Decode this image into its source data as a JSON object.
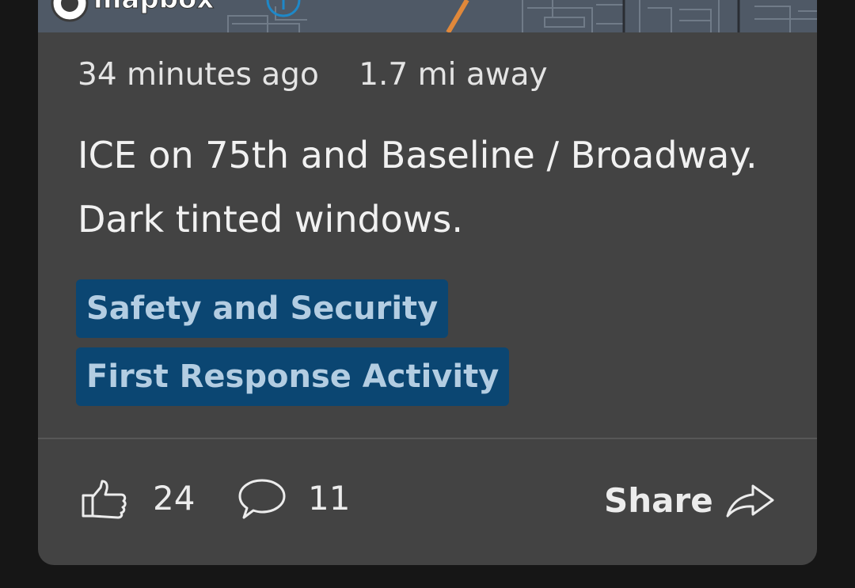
{
  "map": {
    "attribution": "mapbox"
  },
  "post": {
    "time_ago": "34 minutes ago",
    "distance": "1.7 mi away",
    "description": "ICE on 75th and Baseline / Broadway. Dark tinted windows.",
    "tags": [
      "Safety and Security",
      "First Response Activity"
    ]
  },
  "actions": {
    "like_icon": "thumbs-up-icon",
    "like_count": "24",
    "comment_icon": "speech-bubble-icon",
    "comment_count": "11",
    "share_label": "Share",
    "share_icon": "share-arrow-icon"
  },
  "colors": {
    "page_background": "#161616",
    "card_background": "#434343",
    "tag_background": "#0b4672",
    "tag_text": "#b3cde2",
    "map_background": "#4f5966",
    "map_road": "#e0883a"
  }
}
